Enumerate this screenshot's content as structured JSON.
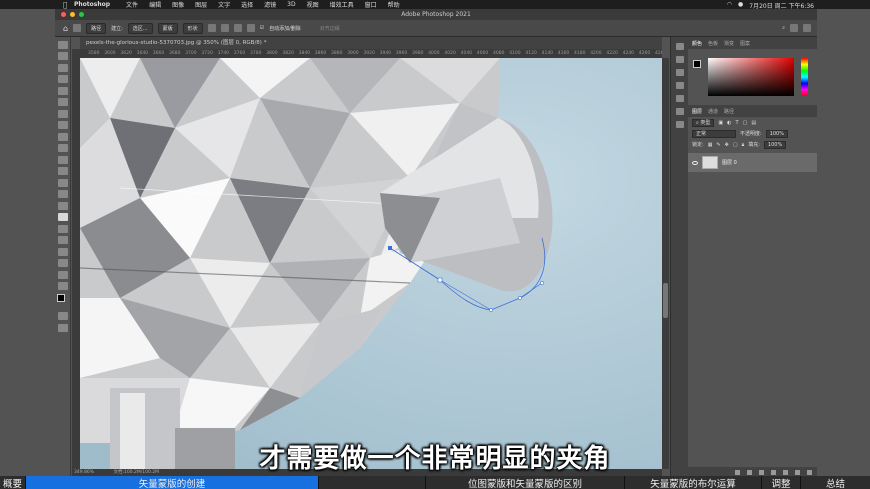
{
  "menubar": {
    "apple_icon": "apple-logo",
    "app": "Photoshop",
    "items": [
      "文件",
      "编辑",
      "图像",
      "图层",
      "文字",
      "选择",
      "滤镜",
      "3D",
      "视图",
      "增效工具",
      "窗口",
      "帮助"
    ],
    "clock": "7月20日 周二 下午6:36"
  },
  "window": {
    "title": "Adobe Photoshop 2021"
  },
  "options": {
    "path_mode": "路径",
    "make_label": "建立:",
    "selection_btn": "选区...",
    "mask_btn": "蒙版",
    "shape_btn": "形状",
    "auto_add_delete": "自动添加/删除",
    "align_edges": "对齐边缘"
  },
  "document": {
    "tab_label": "pexels-the-glorious-studio-5370703.jpg @ 350% (图层 0, RGB/8) *",
    "ruler_ticks": [
      "3580",
      "3600",
      "3620",
      "3640",
      "3660",
      "3680",
      "3700",
      "3720",
      "3740",
      "3760",
      "3780",
      "3800",
      "3820",
      "3840",
      "3860",
      "3880",
      "3900",
      "3920",
      "3940",
      "3960",
      "3980",
      "4000",
      "4020",
      "4040",
      "4060",
      "4080",
      "4100",
      "4120",
      "4140",
      "4160",
      "4180",
      "4200",
      "4220",
      "4240",
      "4260",
      "4280"
    ],
    "zoom": "349.86%",
    "doc_size": "文档:100.2M/100.2M"
  },
  "panels": {
    "color_tabs": [
      "颜色",
      "色板",
      "渐变",
      "图案"
    ],
    "layer_tabs": [
      "图层",
      "通道",
      "路径"
    ],
    "filter_kind": "类型",
    "blend_mode": "正常",
    "opacity_label": "不透明度:",
    "opacity_value": "100%",
    "lock_label": "锁定:",
    "fill_label": "填充:",
    "fill_value": "100%",
    "layer_name": "图层 0"
  },
  "subtitle": "才需要做一个非常明显的夹角",
  "chapters": [
    {
      "label": "概要",
      "active": false
    },
    {
      "label": "矢量蒙版的创建",
      "active": true
    },
    {
      "label": "",
      "active": false
    },
    {
      "label": "位图蒙版和矢量蒙版的区别",
      "active": false
    },
    {
      "label": "矢量蒙版的布尔运算",
      "active": false
    },
    {
      "label": "调整",
      "active": false
    },
    {
      "label": "总结",
      "active": false
    }
  ],
  "colors": {
    "accent": "#1670e0",
    "canvas_bg": "#a9c3d0",
    "foreground": "#000000",
    "background": "#ffffff"
  }
}
